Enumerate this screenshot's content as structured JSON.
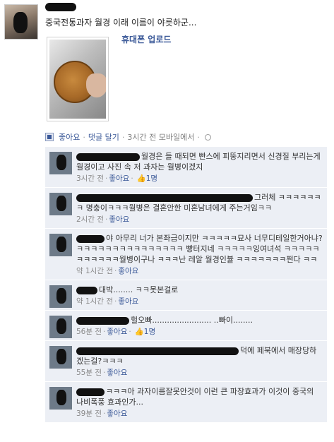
{
  "post": {
    "text": "중국전통과자 월경 이래 이름이 야릇하군...",
    "upload_label": "휴대폰 업로드",
    "actions": {
      "like": "좋아요",
      "comment": "댓글 달기",
      "time": "3시간 전 모바일에서"
    }
  },
  "comments": [
    {
      "text": "월경은 들 때되면 빤스에 피뚱지리면서 신경질 부리는게 월경이고 사진 속 저 과자는 월병이겠지",
      "time": "3시간 전",
      "like": "좋아요",
      "likes": "1명"
    },
    {
      "text": "그러체 ㅋㅋㅋㅋㅋㅋㅋ 명충이ㅋㅋㅋ월병은 결혼안한 미혼남녀에게 주는거임ㅋㅋ",
      "time": "2시간 전",
      "like": "좋아요",
      "likes": ""
    },
    {
      "text": "야 아무리 너가 본좌급이지만 ㅋㅋㅋㅋㅋ묘사 너무디테일한거아냐?ㅋㅋㅋㅋㅋㅋㅋㅋㅋㅋㅋㅋㅋㅋㅋ 빵터지네 ㅋㅋㅋㅋㅋ잉여녀석 ㅋㅋㅋㅋㅋㅋㅋㅋㅋㅋㅋ월병이구나 ㅋㅋㅋ난 레알 월경인뷸 ㅋㅋㅋㅋㅋㅋㅋ쩐다 ㅋㅋ",
      "time": "약 1시간 전",
      "like": "좋아요",
      "likes": ""
    },
    {
      "text": "대박........ ㅋㅋ못본걸로",
      "time": "약 1시간 전",
      "like": "좋아요",
      "likes": ""
    },
    {
      "text": "헐오빠........................ ..빠이........",
      "time": "56분 전",
      "like": "좋아요",
      "likes": "1명"
    },
    {
      "text": "덕에 페북에서 매장당하겠는걸?ㅋㅋㅋ",
      "time": "55분 전",
      "like": "좋아요",
      "likes": ""
    },
    {
      "text": "ㅋㅋㅋ아 과자이름잘못안것이 이런 큰 파장효과가 이것이 중국의 나비폭풍 효과인가...",
      "time": "39분 전",
      "like": "좋아요",
      "likes": ""
    }
  ]
}
